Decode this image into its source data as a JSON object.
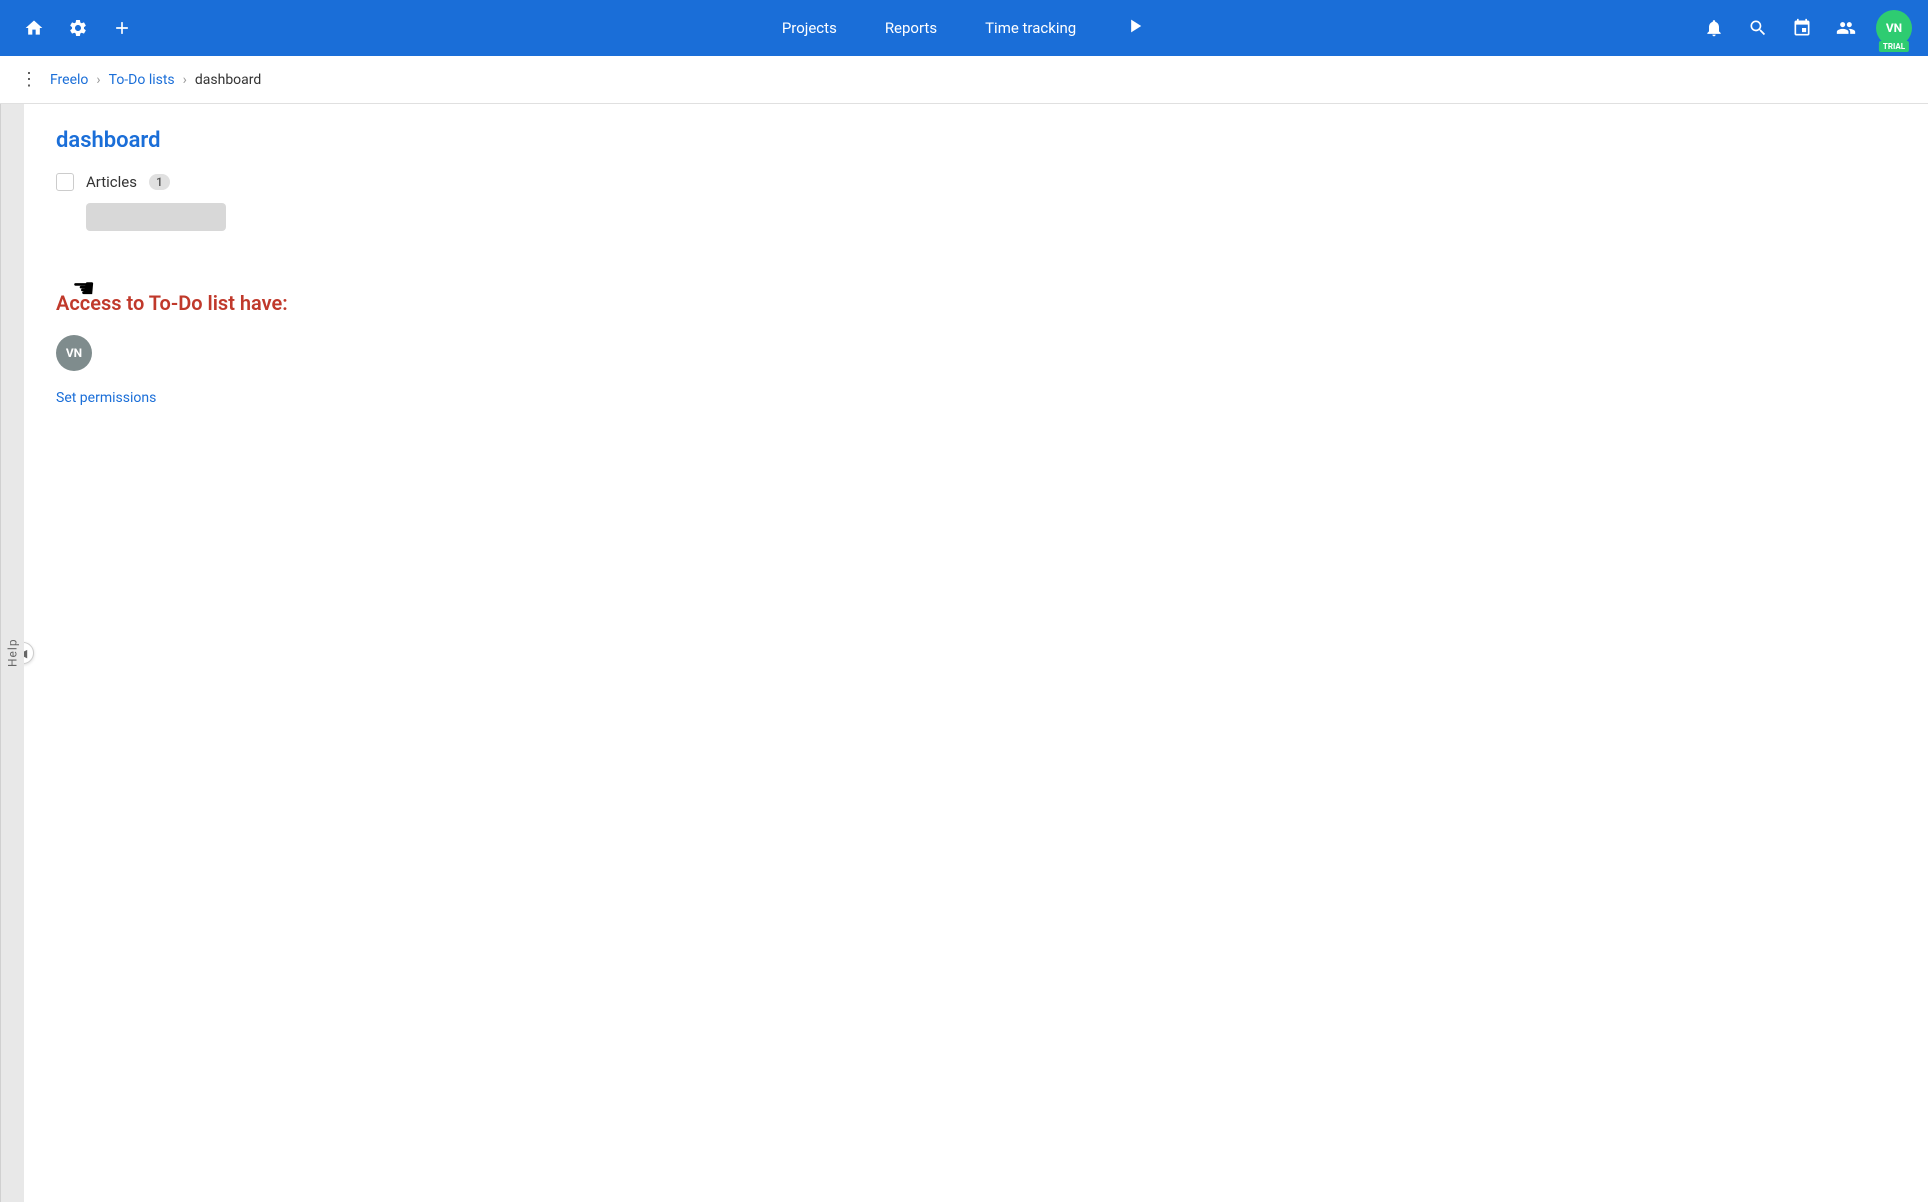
{
  "app": {
    "name": "Freelo"
  },
  "nav": {
    "home_icon": "⌂",
    "settings_icon": "⚙",
    "add_icon": "+",
    "projects_label": "Projects",
    "reports_label": "Reports",
    "time_tracking_label": "Time tracking",
    "play_icon": "▷",
    "bell_icon": "🔔",
    "search_icon": "🔍",
    "calendar_icon": "📅",
    "people_icon": "👥",
    "user_initials": "VN",
    "trial_label": "TRIAL"
  },
  "breadcrumb": {
    "menu_icon": "⋮",
    "root": "Freelo",
    "parent": "To-Do lists",
    "current": "dashboard"
  },
  "help": {
    "label": "Help"
  },
  "content": {
    "dashboard_title": "dashboard",
    "articles_label": "Articles",
    "articles_count": "1",
    "access_title": "Access to To-Do list have:",
    "user_initials": "VN",
    "set_permissions_label": "Set permissions"
  }
}
